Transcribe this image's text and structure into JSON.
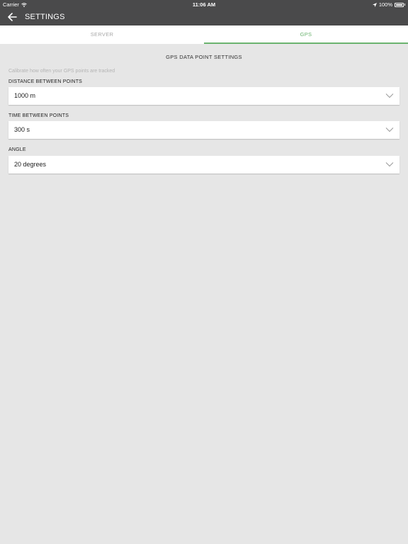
{
  "statusbar": {
    "carrier": "Carrier",
    "time": "11:06 AM",
    "battery_text": "100%"
  },
  "header": {
    "title": "SETTINGS"
  },
  "tabs": [
    {
      "label": "SERVER",
      "active": false
    },
    {
      "label": "GPS",
      "active": true
    }
  ],
  "main": {
    "section_title": "GPS DATA POINT SETTINGS",
    "hint": "Calibrate how often your GPS points are tracked",
    "fields": [
      {
        "label": "DISTANCE BETWEEN POINTS",
        "value": "1000 m"
      },
      {
        "label": "TIME BETWEEN POINTS",
        "value": "300 s"
      },
      {
        "label": "ANGLE",
        "value": "20 degrees"
      }
    ]
  },
  "colors": {
    "bar_bg": "#4a4a4b",
    "accent": "#6bb36f",
    "page_bg": "#e6e6e6"
  }
}
